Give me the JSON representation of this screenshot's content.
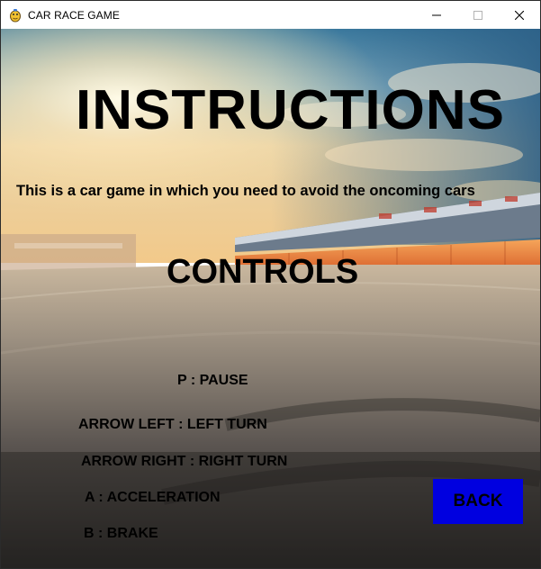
{
  "window": {
    "title": "CAR RACE GAME",
    "icon": "pygame-snake-icon",
    "controls": [
      "minimize-icon",
      "maximize-icon",
      "close-icon"
    ]
  },
  "screen": {
    "heading": "INSTRUCTIONS",
    "intro": "This is a car game in which you need to avoid the oncoming cars",
    "controls_heading": "CONTROLS",
    "controls": [
      "P : PAUSE",
      "ARROW LEFT : LEFT TURN",
      "ARROW RIGHT : RIGHT TURN",
      "A : ACCELERATION",
      "B : BRAKE"
    ],
    "back_button": "BACK"
  },
  "colors": {
    "back_button_bg": "#0000e0",
    "text": "#000000",
    "titlebar_bg": "#ffffff"
  }
}
